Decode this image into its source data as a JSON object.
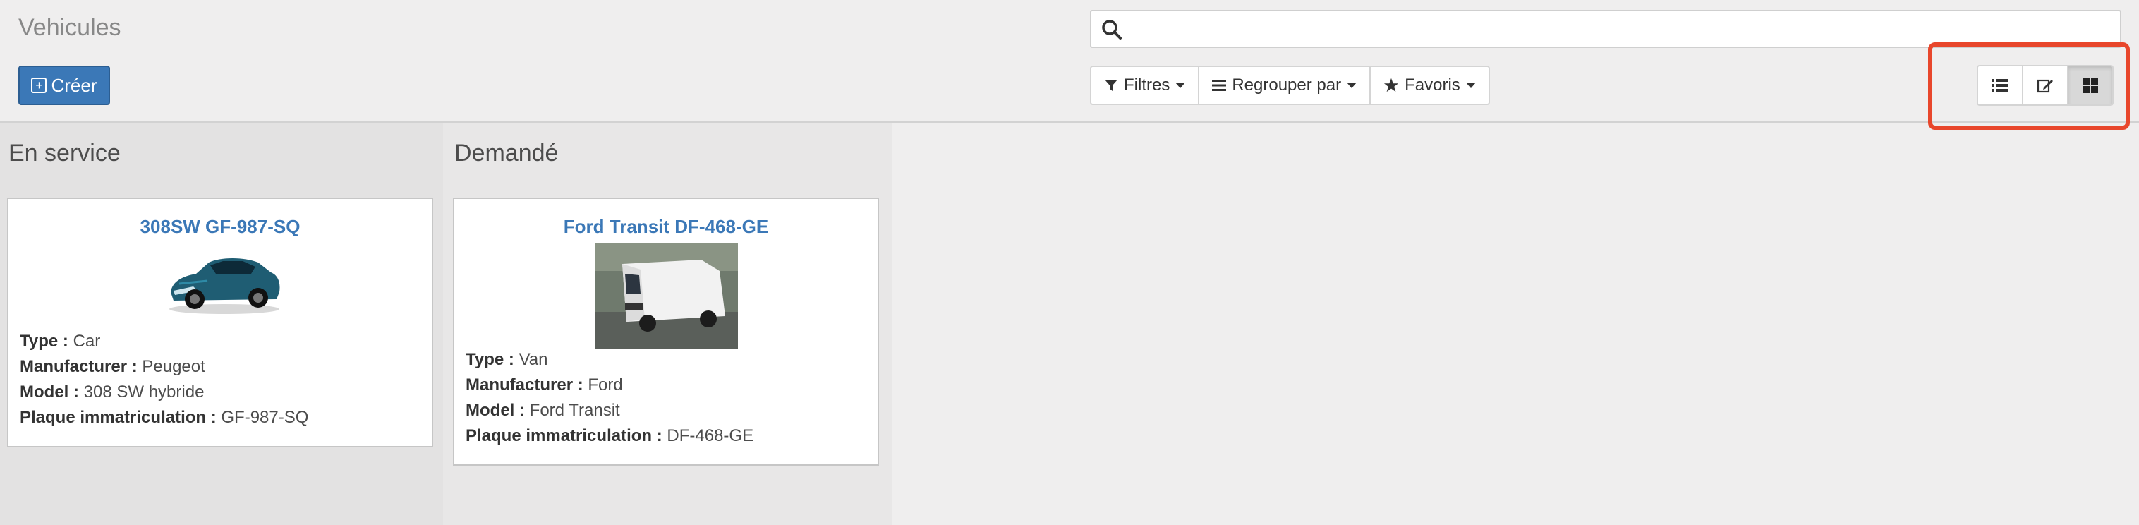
{
  "header": {
    "title": "Vehicules",
    "create_label": "Créer",
    "search_placeholder": ""
  },
  "filters": {
    "filtres": "Filtres",
    "regrouper": "Regrouper par",
    "favoris": "Favoris"
  },
  "view_switch": {
    "items": [
      "list-view",
      "form-view",
      "kanban-view"
    ],
    "active": "kanban-view"
  },
  "columns": [
    {
      "title": "En service",
      "cards": [
        {
          "name": "308SW GF-987-SQ",
          "type_label": "Type :",
          "type": "Car",
          "manufacturer_label": "Manufacturer :",
          "manufacturer": "Peugeot",
          "model_label": "Model :",
          "model": "308 SW hybride",
          "plate_label": "Plaque immatriculation :",
          "plate": "GF-987-SQ"
        }
      ]
    },
    {
      "title": "Demandé",
      "cards": [
        {
          "name": "Ford Transit DF-468-GE",
          "type_label": "Type :",
          "type": "Van",
          "manufacturer_label": "Manufacturer :",
          "manufacturer": "Ford",
          "model_label": "Model :",
          "model": "Ford Transit",
          "plate_label": "Plaque immatriculation :",
          "plate": "DF-468-GE"
        }
      ]
    }
  ],
  "colors": {
    "accent": "#3b78b7",
    "highlight": "#e8462b"
  }
}
